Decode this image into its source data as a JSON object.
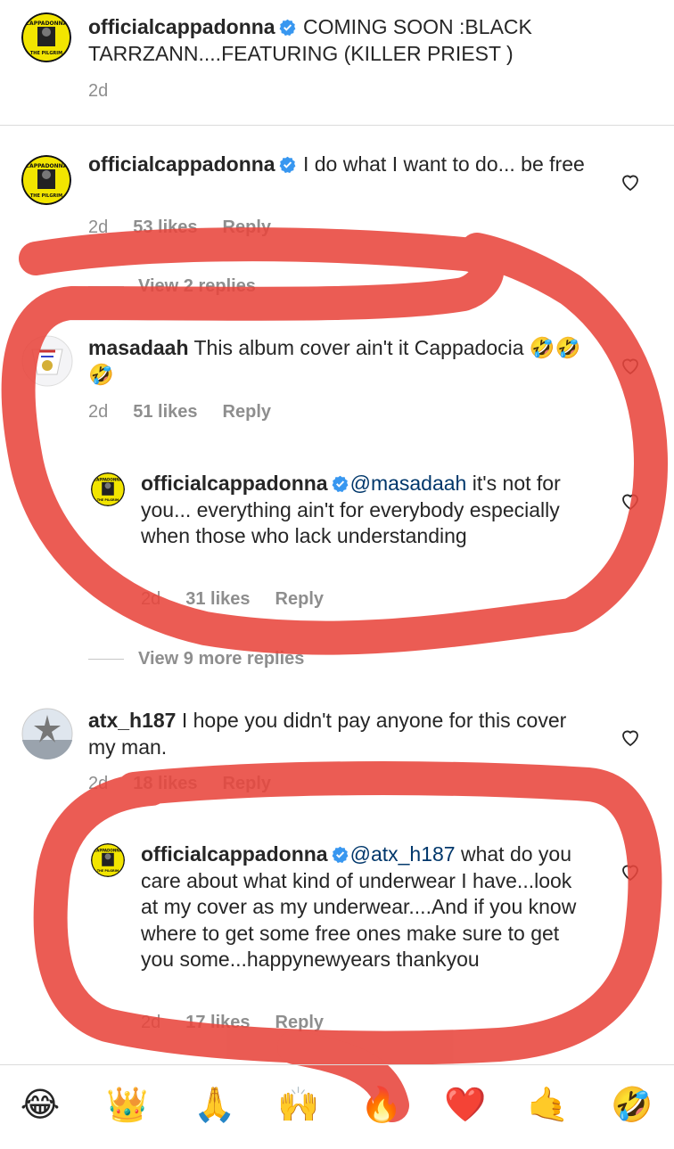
{
  "caption": {
    "username": "officialcappadonna",
    "text": " COMING SOON :BLACK TARRZANN....FEATURING (KILLER PRIEST )",
    "time": "2d"
  },
  "comments": [
    {
      "username": "officialcappadonna",
      "text": " I do what I want to do... be free",
      "time": "2d",
      "likes": "53 likes",
      "reply": "Reply",
      "view_replies": "View 2 replies"
    },
    {
      "username": "masadaah",
      "text": " This album cover ain't it Cappadocia 🤣🤣🤣",
      "time": "2d",
      "likes": "51 likes",
      "reply": "Reply"
    },
    {
      "username": "officialcappadonna",
      "mention": "@masadaah",
      "text": " it's not for you... everything ain't for everybody especially when those who lack understanding",
      "time": "2d",
      "likes": "31 likes",
      "reply": "Reply",
      "view_replies": "View 9 more replies"
    },
    {
      "username": "atx_h187",
      "text": " I hope you didn't pay anyone for this cover my man.",
      "time": "2d",
      "likes": "18 likes",
      "reply": "Reply"
    },
    {
      "username": "officialcappadonna",
      "mention": "@atx_h187",
      "text": " what do you care about what kind of underwear I have...look at my cover as my underwear....And if you know where to get some free ones make sure to get you some...happynewyears thankyou",
      "time": "2d",
      "likes": "17 likes",
      "reply": "Reply"
    }
  ],
  "avatar_labels": {
    "top": "CAPPADONNA",
    "bottom": "THE PILGRIM"
  },
  "emoji_bar": [
    "😂",
    "👑",
    "🙏",
    "🙌",
    "🔥",
    "❤️",
    "🤙",
    "🤣"
  ],
  "colors": {
    "verified": "#3897f0",
    "mention": "#00376b",
    "annotation": "#e8453c",
    "avatar_bg": "#f2e500"
  }
}
